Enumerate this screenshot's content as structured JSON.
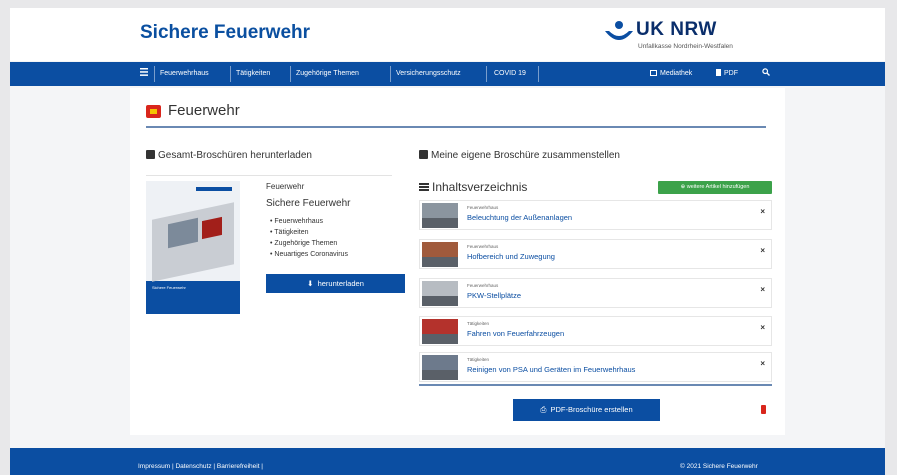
{
  "header": {
    "site_title": "Sichere Feuerwehr",
    "logo_text": "UK NRW",
    "logo_subtitle": "Unfallkasse Nordrhein-Westfalen"
  },
  "nav": {
    "menu_icon": "menu-icon",
    "items": [
      {
        "label": "Feuerwehrhaus"
      },
      {
        "label": "Tätigkeiten"
      },
      {
        "label": "Zugehörige Themen"
      },
      {
        "label": "Versicherungsschutz"
      },
      {
        "label": "COVID 19"
      }
    ],
    "mediathek": "Mediathek",
    "pdf": "PDF",
    "search_icon": "search-icon"
  },
  "page": {
    "title": "Feuerwehr"
  },
  "left": {
    "section_title": "Gesamt-Broschüren herunterladen",
    "brochure_small_title": "Feuerwehr",
    "brochure_title": "Sichere Feuerwehr",
    "brochure_items": [
      "Feuerwehrhaus",
      "Tätigkeiten",
      "Zugehörige Themen",
      "Neuartiges Coronavirus"
    ],
    "download_label": "herunterladen",
    "thumb_label": "Sichere Feuerwehr"
  },
  "right": {
    "section_title": "Meine eigene Broschüre zusammenstellen",
    "toc_title": "Inhaltsverzeichnis",
    "add_button": "weitere Artikel hinzufügen",
    "items": [
      {
        "category": "Feuerwehrhaus",
        "title": "Beleuchtung der Außenanlagen"
      },
      {
        "category": "Feuerwehrhaus",
        "title": "Hofbereich und Zuwegung"
      },
      {
        "category": "Feuerwehrhaus",
        "title": "PKW-Stellplätze"
      },
      {
        "category": "Tätigkeiten",
        "title": "Fahren von Feuerfahrzeugen"
      },
      {
        "category": "Tätigkeiten",
        "title": "Reinigen von PSA und Geräten im Feuerwehrhaus"
      }
    ],
    "remove_symbol": "×",
    "pdf_button": "PDF-Broschüre erstellen"
  },
  "footer": {
    "links": "Impressum   |   Datenschutz   |   Barrierefreiheit   |",
    "copyright": "© 2021  Sichere Feuerwehr"
  },
  "colors": {
    "brand_blue": "#0b4ea2",
    "accent_green": "#3ca24a",
    "accent_red": "#d9261c"
  }
}
